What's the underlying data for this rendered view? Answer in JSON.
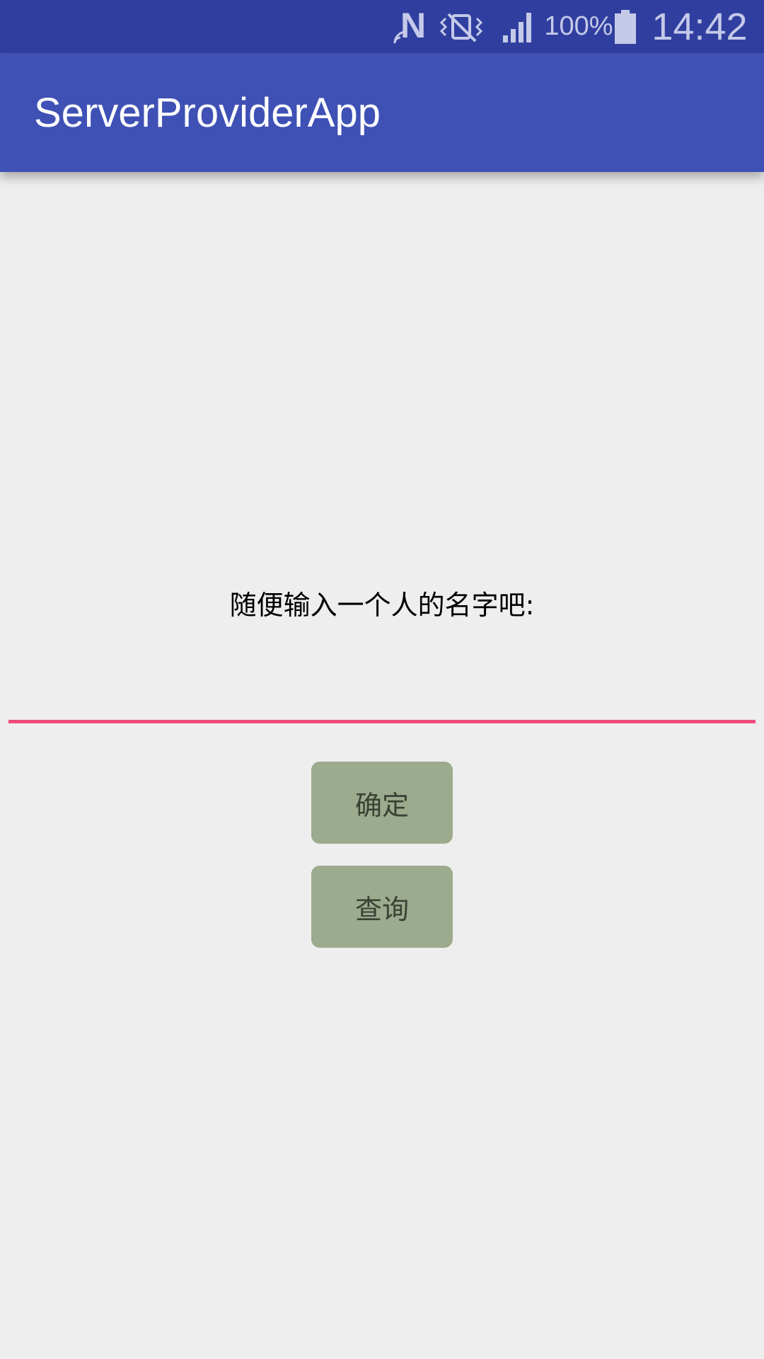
{
  "status_bar": {
    "icons": [
      "nfc-icon",
      "vibrate-icon",
      "signal-icon",
      "battery-icon"
    ],
    "battery_percent": "100%",
    "time": "14:42",
    "background_color": "#303f9f"
  },
  "app_bar": {
    "title": "ServerProviderApp",
    "background_color": "#3f51b5"
  },
  "main": {
    "prompt": "随便输入一个人的名字吧:",
    "name_input": {
      "value": "",
      "placeholder": "",
      "underline_color": "#ee4c7c"
    },
    "confirm_button_label": "确定",
    "query_button_label": "查询",
    "button_color": "#9caa8d"
  }
}
